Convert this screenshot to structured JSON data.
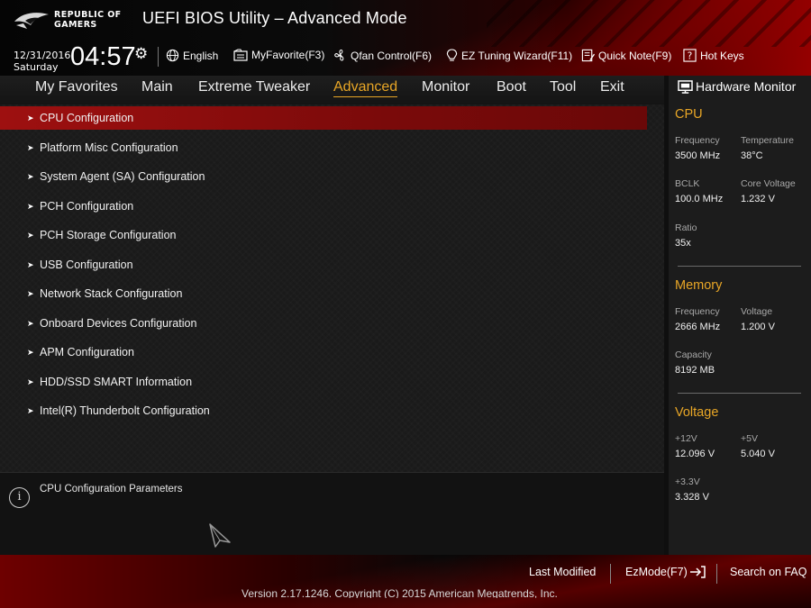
{
  "header": {
    "logo_line1": "REPUBLIC OF",
    "logo_line2": "GAMERS",
    "title": "UEFI BIOS Utility – Advanced Mode",
    "date": "12/31/2016",
    "day": "Saturday",
    "time": "04:57",
    "settings_icon": "gear-icon"
  },
  "toolbar": {
    "language": "English",
    "myfavorite": "MyFavorite(F3)",
    "qfan": "Qfan Control(F6)",
    "ez_tuning": "EZ Tuning Wizard(F11)",
    "quick_note": "Quick Note(F9)",
    "hot_keys": "Hot Keys"
  },
  "tabs": [
    {
      "label": "My Favorites"
    },
    {
      "label": "Main"
    },
    {
      "label": "Extreme Tweaker"
    },
    {
      "label": "Advanced",
      "active": true
    },
    {
      "label": "Monitor"
    },
    {
      "label": "Boot"
    },
    {
      "label": "Tool"
    },
    {
      "label": "Exit"
    }
  ],
  "menu": [
    "CPU Configuration",
    "Platform Misc Configuration",
    "System Agent (SA) Configuration",
    "PCH Configuration",
    "PCH Storage Configuration",
    "USB Configuration",
    "Network Stack Configuration",
    "Onboard Devices Configuration",
    "APM Configuration",
    "HDD/SSD SMART Information",
    "Intel(R) Thunderbolt Configuration"
  ],
  "selected_menu": "CPU Configuration",
  "description": "CPU Configuration Parameters",
  "hardware_monitor": {
    "title": "Hardware Monitor",
    "cpu": {
      "heading": "CPU",
      "frequency_label": "Frequency",
      "frequency": "3500 MHz",
      "temperature_label": "Temperature",
      "temperature": "38°C",
      "bclk_label": "BCLK",
      "bclk": "100.0 MHz",
      "core_voltage_label": "Core Voltage",
      "core_voltage": "1.232 V",
      "ratio_label": "Ratio",
      "ratio": "35x"
    },
    "memory": {
      "heading": "Memory",
      "frequency_label": "Frequency",
      "frequency": "2666 MHz",
      "voltage_label": "Voltage",
      "voltage": "1.200 V",
      "capacity_label": "Capacity",
      "capacity": "8192 MB"
    },
    "voltage": {
      "heading": "Voltage",
      "v12_label": "+12V",
      "v12": "12.096 V",
      "v5_label": "+5V",
      "v5": "5.040 V",
      "v33_label": "+3.3V",
      "v33": "3.328 V"
    }
  },
  "footer": {
    "last_modified": "Last Modified",
    "ezmode": "EzMode(F7)",
    "search_faq": "Search on FAQ",
    "version": "Version 2.17.1246. Copyright (C) 2015 American Megatrends, Inc."
  },
  "colors": {
    "accent": "#e8a626",
    "selected_row": "#9e1010",
    "brand_red": "#b30000"
  }
}
